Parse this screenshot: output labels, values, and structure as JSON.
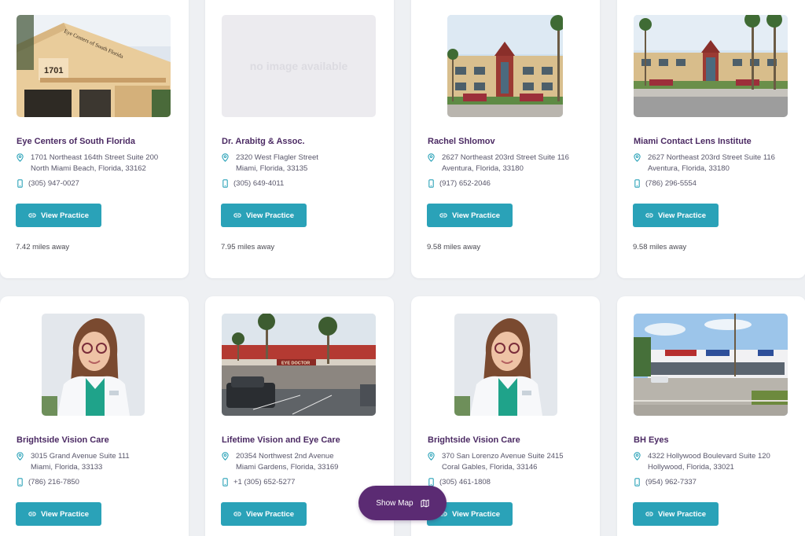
{
  "colors": {
    "accent": "#2aa2b8",
    "heading": "#4b2a63",
    "map_button": "#5b2b73",
    "icon": "#2aa2b8"
  },
  "icons": {
    "address": "map-pin-icon",
    "phone": "phone-icon",
    "view_practice": "link-icon",
    "map": "map-icon"
  },
  "practices": [
    {
      "name": "Eye Centers of South Florida",
      "address_line1": "1701 Northeast 164th Street Suite 200",
      "address_line2": "North Miami Beach, Florida, 33162",
      "phone": "(305) 947-0027",
      "button_label": "View Practice",
      "distance": "7.42 miles away",
      "photo_type": "building-storefront",
      "photo_text": "Eye Centers of South Florida",
      "photo_number": "1701"
    },
    {
      "name": "Dr. Arabitg & Assoc.",
      "address_line1": "2320 West Flagler Street",
      "address_line2": "Miami, Florida, 33135",
      "phone": "(305) 649-4011",
      "button_label": "View Practice",
      "distance": "7.95 miles away",
      "photo_type": "placeholder",
      "placeholder_text": "no image available"
    },
    {
      "name": "Rachel Shlomov",
      "address_line1": "2627 Northeast 203rd Street Suite 116",
      "address_line2": "Aventura, Florida, 33180",
      "phone": "(917) 652-2046",
      "button_label": "View Practice",
      "distance": "9.58 miles away",
      "photo_type": "office-building"
    },
    {
      "name": "Miami Contact Lens Institute",
      "address_line1": "2627 Northeast 203rd Street Suite 116",
      "address_line2": "Aventura, Florida, 33180",
      "phone": "(786) 296-5554",
      "button_label": "View Practice",
      "distance": "9.58 miles away",
      "photo_type": "office-building-street"
    },
    {
      "name": "Brightside Vision Care",
      "address_line1": "3015 Grand Avenue Suite 111",
      "address_line2": "Miami, Florida, 33133",
      "phone": "(786) 216-7850",
      "button_label": "View Practice",
      "photo_type": "doctor-portrait"
    },
    {
      "name": "Lifetime Vision and Eye Care",
      "address_line1": "20354 Northwest 2nd Avenue",
      "address_line2": "Miami Gardens, Florida, 33169",
      "phone": "+1 (305) 652-5277",
      "button_label": "View Practice",
      "photo_type": "strip-mall",
      "photo_text": "EYE DOCTOR"
    },
    {
      "name": "Brightside Vision Care",
      "address_line1": "370 San Lorenzo Avenue Suite 2415",
      "address_line2": "Coral Gables, Florida, 33146",
      "phone": "(305) 461-1808",
      "button_label": "View Practice",
      "photo_type": "doctor-portrait"
    },
    {
      "name": "BH Eyes",
      "address_line1": "4322 Hollywood Boulevard Suite 120",
      "address_line2": "Hollywood, Florida, 33021",
      "phone": "(954) 962-7337",
      "button_label": "View Practice",
      "photo_type": "retail-building"
    }
  ],
  "show_map": {
    "label": "Show Map"
  }
}
